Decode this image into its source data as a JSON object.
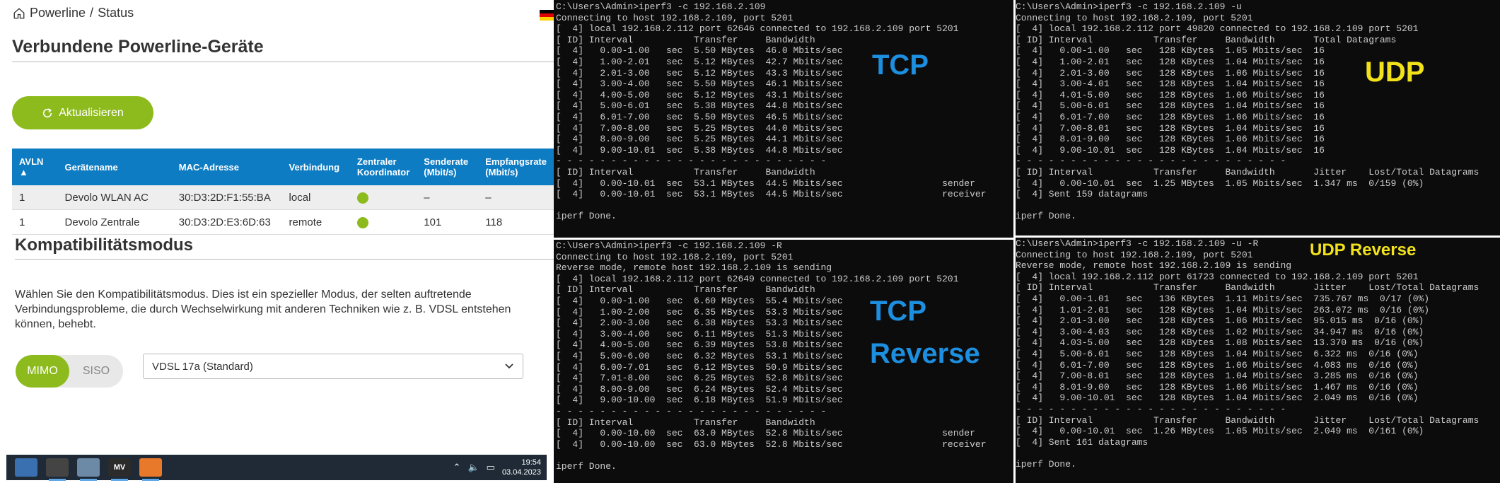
{
  "left": {
    "breadcrumb": {
      "root": "Powerline",
      "sep": "/",
      "current": "Status"
    },
    "title": "Verbundene Powerline-Geräte",
    "refresh_label": "Aktualisieren",
    "table": {
      "headers": [
        "AVLN",
        "Gerätename",
        "MAC-Adresse",
        "Verbindung",
        "Zentraler Koordinator",
        "Senderate (Mbit/s)",
        "Empfangsrate (Mbit/s)"
      ],
      "rows": [
        {
          "avln": "1",
          "name": "Devolo WLAN AC",
          "mac": "30:D3:2D:F1:55:BA",
          "conn": "local",
          "send": "–",
          "recv": "–"
        },
        {
          "avln": "1",
          "name": "Devolo Zentrale",
          "mac": "30:D3:2D:E3:6D:63",
          "conn": "remote",
          "send": "101",
          "recv": "118"
        }
      ]
    },
    "compat_title": "Kompatibilitätsmodus",
    "compat_desc": "Wählen Sie den Kompatibilitätsmodus. Dies ist ein spezieller Modus, der selten auftretende Verbindungsprobleme, die durch Wechselwirkung mit anderen Techniken wie z. B. VDSL entstehen können, behebt.",
    "mode_mimo": "MIMO",
    "mode_siso": "SISO",
    "select_value": "VDSL 17a (Standard)",
    "clock_time": "19:54",
    "clock_date": "03.04.2023"
  },
  "terminals": {
    "tcp": "C:\\Users\\Admin>iperf3 -c 192.168.2.109\nConnecting to host 192.168.2.109, port 5201\n[  4] local 192.168.2.112 port 62646 connected to 192.168.2.109 port 5201\n[ ID] Interval           Transfer     Bandwidth\n[  4]   0.00-1.00   sec  5.50 MBytes  46.0 Mbits/sec\n[  4]   1.00-2.01   sec  5.12 MBytes  42.7 Mbits/sec\n[  4]   2.01-3.00   sec  5.12 MBytes  43.3 Mbits/sec\n[  4]   3.00-4.00   sec  5.50 MBytes  46.1 Mbits/sec\n[  4]   4.00-5.00   sec  5.12 MBytes  43.1 Mbits/sec\n[  4]   5.00-6.01   sec  5.38 MBytes  44.8 Mbits/sec\n[  4]   6.01-7.00   sec  5.50 MBytes  46.5 Mbits/sec\n[  4]   7.00-8.00   sec  5.25 MBytes  44.0 Mbits/sec\n[  4]   8.00-9.00   sec  5.25 MBytes  44.1 Mbits/sec\n[  4]   9.00-10.01  sec  5.38 MBytes  44.8 Mbits/sec\n- - - - - - - - - - - - - - - - - - - - - - - - -\n[ ID] Interval           Transfer     Bandwidth\n[  4]   0.00-10.01  sec  53.1 MBytes  44.5 Mbits/sec                  sender\n[  4]   0.00-10.01  sec  53.1 MBytes  44.5 Mbits/sec                  receiver\n\niperf Done.",
    "tcp_rev": "C:\\Users\\Admin>iperf3 -c 192.168.2.109 -R\nConnecting to host 192.168.2.109, port 5201\nReverse mode, remote host 192.168.2.109 is sending\n[  4] local 192.168.2.112 port 62649 connected to 192.168.2.109 port 5201\n[ ID] Interval           Transfer     Bandwidth\n[  4]   0.00-1.00   sec  6.60 MBytes  55.4 Mbits/sec\n[  4]   1.00-2.00   sec  6.35 MBytes  53.3 Mbits/sec\n[  4]   2.00-3.00   sec  6.38 MBytes  53.3 Mbits/sec\n[  4]   3.00-4.00   sec  6.11 MBytes  51.3 Mbits/sec\n[  4]   4.00-5.00   sec  6.39 MBytes  53.8 Mbits/sec\n[  4]   5.00-6.00   sec  6.32 MBytes  53.1 Mbits/sec\n[  4]   6.00-7.01   sec  6.12 MBytes  50.9 Mbits/sec\n[  4]   7.01-8.00   sec  6.25 MBytes  52.8 Mbits/sec\n[  4]   8.00-9.00   sec  6.24 MBytes  52.4 Mbits/sec\n[  4]   9.00-10.00  sec  6.18 MBytes  51.9 Mbits/sec\n- - - - - - - - - - - - - - - - - - - - - - - - -\n[ ID] Interval           Transfer     Bandwidth\n[  4]   0.00-10.00  sec  63.0 MBytes  52.8 Mbits/sec                  sender\n[  4]   0.00-10.00  sec  63.0 MBytes  52.8 Mbits/sec                  receiver\n\niperf Done.",
    "udp": "C:\\Users\\Admin>iperf3 -c 192.168.2.109 -u\nConnecting to host 192.168.2.109, port 5201\n[  4] local 192.168.2.112 port 49820 connected to 192.168.2.109 port 5201\n[ ID] Interval           Transfer     Bandwidth       Total Datagrams\n[  4]   0.00-1.00   sec   128 KBytes  1.05 Mbits/sec  16\n[  4]   1.00-2.01   sec   128 KBytes  1.04 Mbits/sec  16\n[  4]   2.01-3.00   sec   128 KBytes  1.06 Mbits/sec  16\n[  4]   3.00-4.01   sec   128 KBytes  1.04 Mbits/sec  16\n[  4]   4.01-5.00   sec   128 KBytes  1.06 Mbits/sec  16\n[  4]   5.00-6.01   sec   128 KBytes  1.04 Mbits/sec  16\n[  4]   6.01-7.00   sec   128 KBytes  1.06 Mbits/sec  16\n[  4]   7.00-8.01   sec   128 KBytes  1.04 Mbits/sec  16\n[  4]   8.01-9.00   sec   128 KBytes  1.06 Mbits/sec  16\n[  4]   9.00-10.01  sec   128 KBytes  1.04 Mbits/sec  16\n- - - - - - - - - - - - - - - - - - - - - - - - -\n[ ID] Interval           Transfer     Bandwidth       Jitter    Lost/Total Datagrams\n[  4]   0.00-10.01  sec  1.25 MBytes  1.05 Mbits/sec  1.347 ms  0/159 (0%)\n[  4] Sent 159 datagrams\n\niperf Done.",
    "udp_rev": "C:\\Users\\Admin>iperf3 -c 192.168.2.109 -u -R\nConnecting to host 192.168.2.109, port 5201\nReverse mode, remote host 192.168.2.109 is sending\n[  4] local 192.168.2.112 port 61723 connected to 192.168.2.109 port 5201\n[ ID] Interval           Transfer     Bandwidth       Jitter    Lost/Total Datagrams\n[  4]   0.00-1.01   sec   136 KBytes  1.11 Mbits/sec  735.767 ms  0/17 (0%)\n[  4]   1.01-2.01   sec   128 KBytes  1.04 Mbits/sec  263.072 ms  0/16 (0%)\n[  4]   2.01-3.00   sec   128 KBytes  1.06 Mbits/sec  95.015 ms  0/16 (0%)\n[  4]   3.00-4.03   sec   128 KBytes  1.02 Mbits/sec  34.947 ms  0/16 (0%)\n[  4]   4.03-5.00   sec   128 KBytes  1.08 Mbits/sec  13.370 ms  0/16 (0%)\n[  4]   5.00-6.01   sec   128 KBytes  1.04 Mbits/sec  6.322 ms  0/16 (0%)\n[  4]   6.01-7.00   sec   128 KBytes  1.06 Mbits/sec  4.083 ms  0/16 (0%)\n[  4]   7.00-8.01   sec   128 KBytes  1.04 Mbits/sec  3.285 ms  0/16 (0%)\n[  4]   8.01-9.00   sec   128 KBytes  1.06 Mbits/sec  1.467 ms  0/16 (0%)\n[  4]   9.00-10.01  sec   128 KBytes  1.04 Mbits/sec  2.049 ms  0/16 (0%)\n- - - - - - - - - - - - - - - - - - - - - - - - -\n[ ID] Interval           Transfer     Bandwidth       Jitter    Lost/Total Datagrams\n[  4]   0.00-10.01  sec  1.26 MBytes  1.05 Mbits/sec  2.049 ms  0/161 (0%)\n[  4] Sent 161 datagrams\n\niperf Done."
  },
  "labels": {
    "tcp": "TCP",
    "tcp_rev_line1": "TCP",
    "tcp_rev_line2": "Reverse",
    "udp": "UDP",
    "udp_rev": "UDP Reverse"
  },
  "colors": {
    "accent_green": "#8dbb1d",
    "table_header_blue": "#0e7cc3",
    "label_blue": "#1d8fe0",
    "label_yellow": "#f2e21b"
  }
}
